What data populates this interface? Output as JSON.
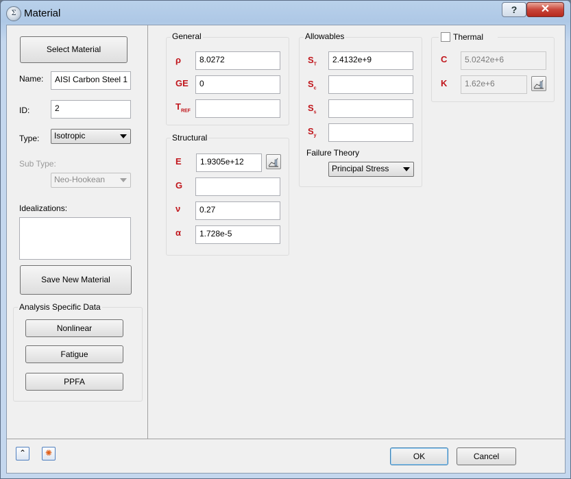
{
  "window": {
    "title": "Material",
    "help_label": "?",
    "close_label": "✕",
    "icon_glyph": "Σ"
  },
  "left": {
    "select_material_label": "Select Material",
    "name_label": "Name:",
    "name_value": "AISI Carbon Steel 1",
    "id_label": "ID:",
    "id_value": "2",
    "type_label": "Type:",
    "type_value": "Isotropic",
    "subtype_label": "Sub Type:",
    "subtype_value": "Neo-Hookean",
    "idealizations_label": "Idealizations:",
    "save_new_label": "Save New Material",
    "analysis_title": "Analysis Specific Data",
    "nonlinear_label": "Nonlinear",
    "fatigue_label": "Fatigue",
    "ppfa_label": "PPFA"
  },
  "general": {
    "title": "General",
    "rho_symbol": "ρ",
    "rho_value": "8.0272",
    "ge_symbol": "GE",
    "ge_value": "0",
    "tref_symbol": "T",
    "tref_sub": "REF",
    "tref_value": ""
  },
  "structural": {
    "title": "Structural",
    "e_symbol": "E",
    "e_value": "1.9305e+12",
    "g_symbol": "G",
    "g_value": "",
    "nu_symbol": "ν",
    "nu_value": "0.27",
    "alpha_symbol": "α",
    "alpha_value": "1.728e-5"
  },
  "allowables": {
    "title": "Allowables",
    "st_symbol": "S",
    "st_sub": "T",
    "st_value": "2.4132e+9",
    "sc_symbol": "S",
    "sc_sub": "c",
    "sc_value": "",
    "ss_symbol": "S",
    "ss_sub": "s",
    "ss_value": "",
    "sy_symbol": "S",
    "sy_sub": "y",
    "sy_value": "",
    "failure_theory_label": "Failure Theory",
    "failure_theory_value": "Principal Stress"
  },
  "thermal": {
    "title": "Thermal",
    "checked": false,
    "c_symbol": "C",
    "c_value": "5.0242e+6",
    "k_symbol": "K",
    "k_value": "1.62e+6"
  },
  "footer": {
    "ok_label": "OK",
    "cancel_label": "Cancel"
  },
  "colors": {
    "symbol_red": "#c0151b",
    "titlebar": "#b9d1ea",
    "client_bg": "#f0f0f0"
  },
  "icons": [
    "app-icon",
    "help-icon",
    "close-icon",
    "graph-icon",
    "collapse-icon",
    "settings-icon",
    "dropdown-arrow-icon"
  ]
}
